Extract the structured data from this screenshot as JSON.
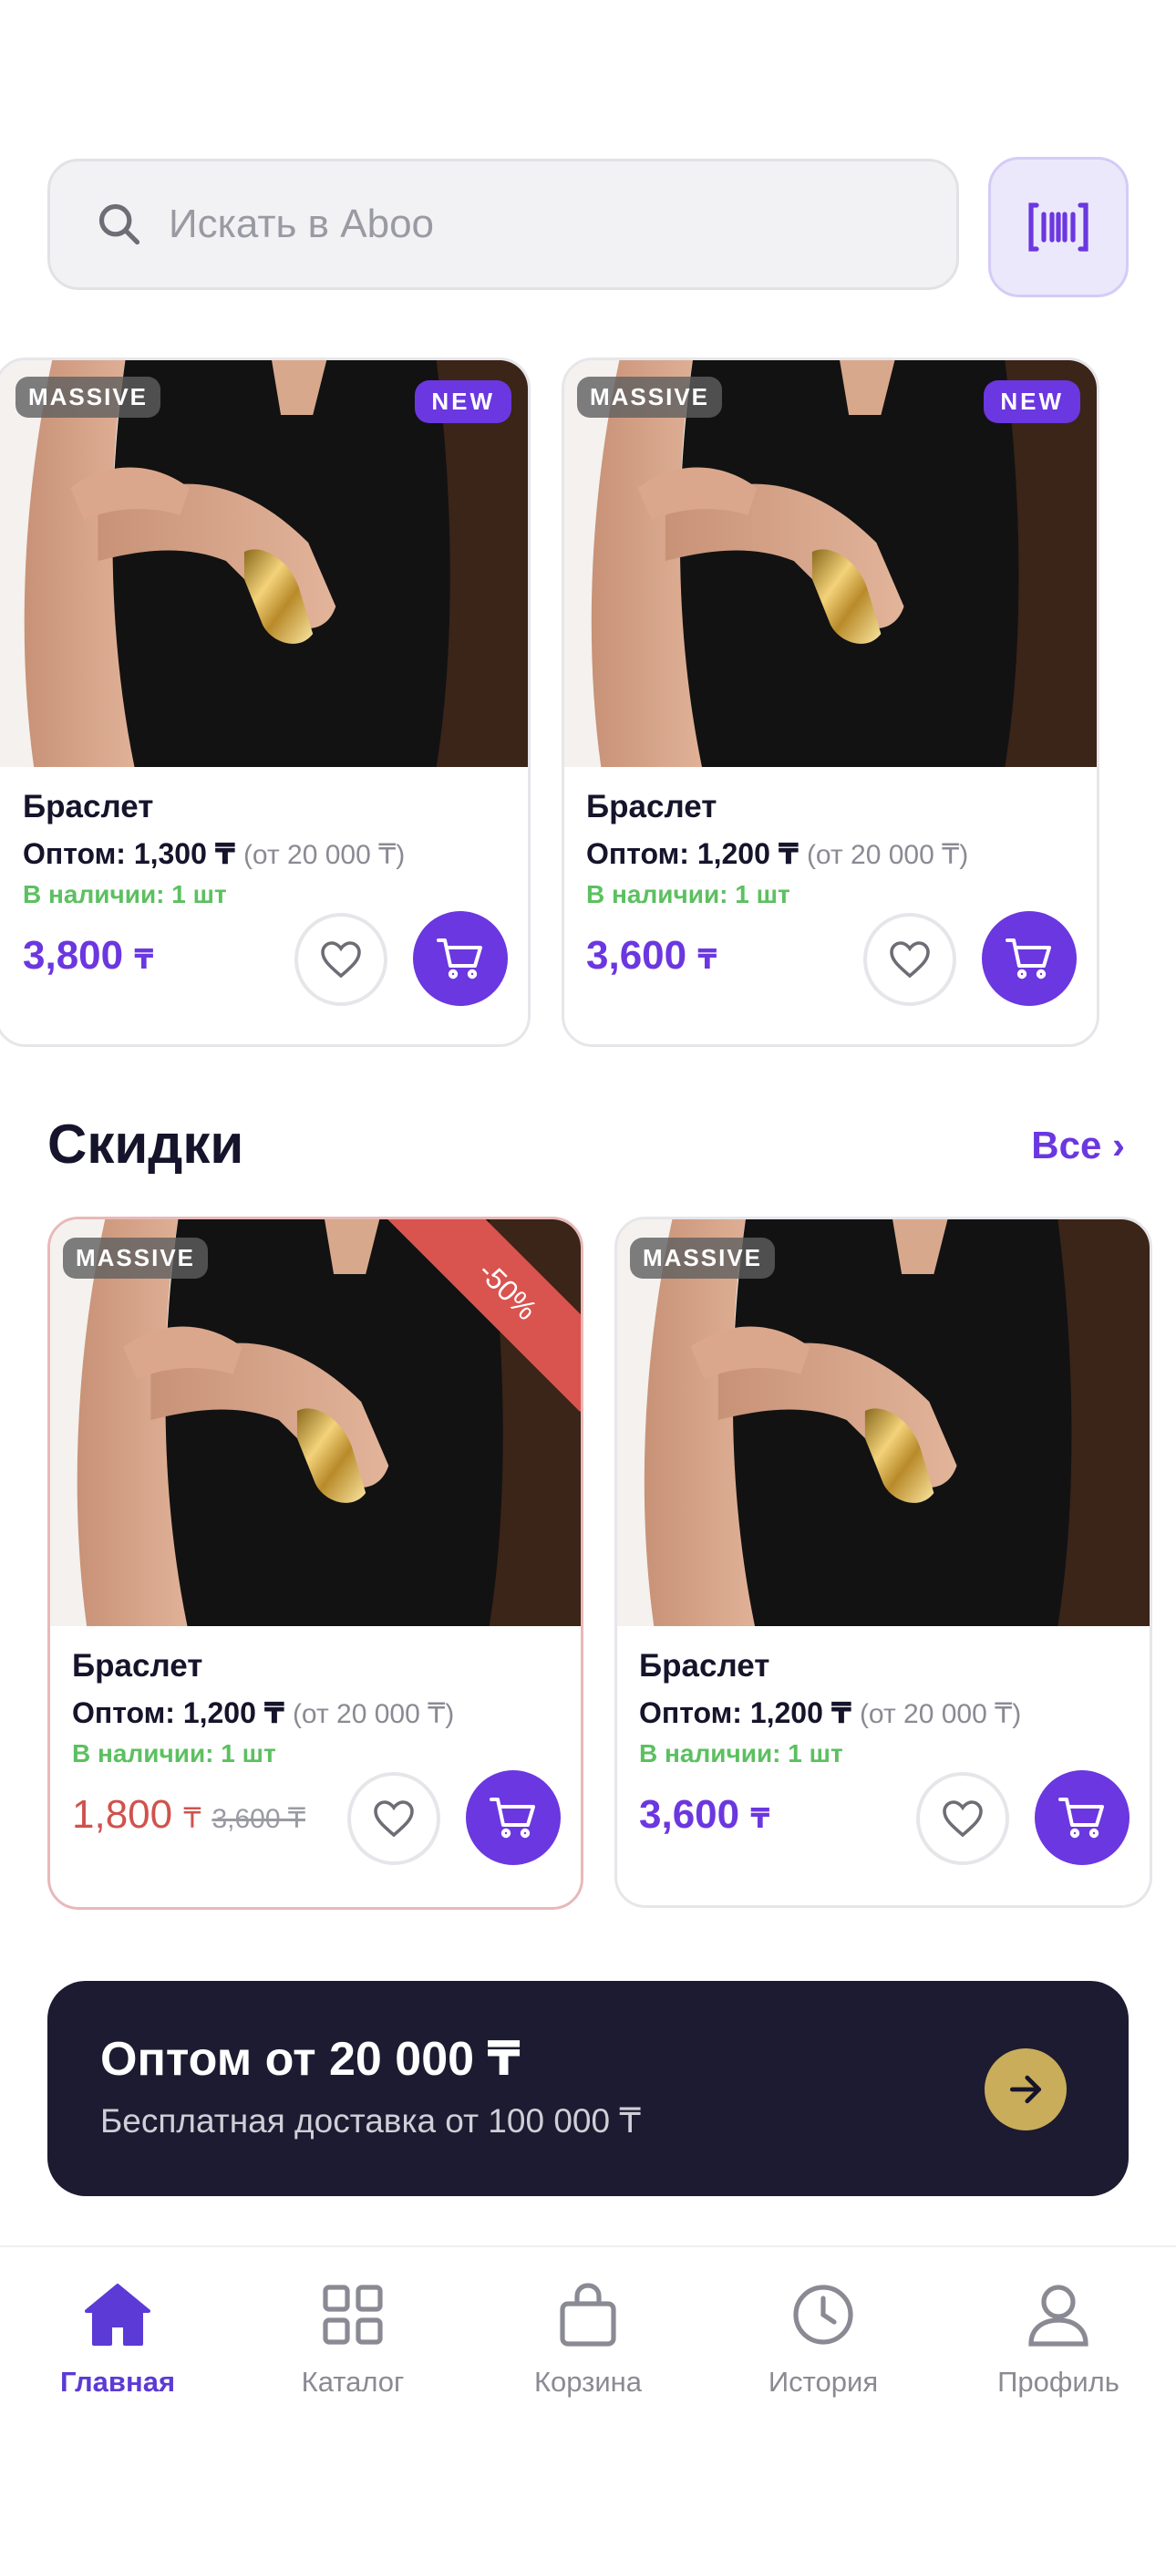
{
  "search": {
    "placeholder": "Искать в Aboo"
  },
  "colors": {
    "accent": "#6b37e0",
    "sale": "#d0524d",
    "in_stock": "#5cc060",
    "banner_bg": "#1c1b31",
    "banner_arrow": "#c9ad5b"
  },
  "icons": {
    "search": "search-icon",
    "scan": "barcode-scan-icon",
    "favorite": "heart-icon",
    "cart": "cart-icon"
  },
  "new_products": [
    {
      "badge": "MASSIVE",
      "tag": "NEW",
      "title": "Браслет",
      "wholesale_label": "Оптом:",
      "wholesale_price": "1,300 ₸",
      "wholesale_min": "(от 20 000 ₸)",
      "stock": "В наличии: 1 шт",
      "price": "3,800",
      "currency": "₸"
    },
    {
      "badge": "MASSIVE",
      "tag": "NEW",
      "title": "Браслет",
      "wholesale_label": "Оптом:",
      "wholesale_price": "1,200 ₸",
      "wholesale_min": "(от 20 000 ₸)",
      "stock": "В наличии: 1 шт",
      "price": "3,600",
      "currency": "₸"
    }
  ],
  "discounts": {
    "title": "Скидки",
    "all_label": "Все ›",
    "products": [
      {
        "badge": "MASSIVE",
        "discount": "-50%",
        "title": "Браслет",
        "wholesale_label": "Оптом:",
        "wholesale_price": "1,200 ₸",
        "wholesale_min": "(от 20 000 ₸)",
        "stock": "В наличии: 1 шт",
        "price": "1,800",
        "currency": "₸",
        "old_price": "3,600 ₸"
      },
      {
        "badge": "MASSIVE",
        "title": "Браслет",
        "wholesale_label": "Оптом:",
        "wholesale_price": "1,200 ₸",
        "wholesale_min": "(от 20 000 ₸)",
        "stock": "В наличии: 1 шт",
        "price": "3,600",
        "currency": "₸"
      }
    ]
  },
  "banner": {
    "title": "Оптом от 20 000 ₸",
    "subtitle": "Бесплатная доставка от 100 000 ₸"
  },
  "tabbar": [
    {
      "label": "Главная",
      "icon": "home-icon",
      "active": true
    },
    {
      "label": "Каталог",
      "icon": "grid-icon",
      "active": false
    },
    {
      "label": "Корзина",
      "icon": "bag-icon",
      "active": false
    },
    {
      "label": "История",
      "icon": "clock-icon",
      "active": false
    },
    {
      "label": "Профиль",
      "icon": "user-icon",
      "active": false
    }
  ]
}
